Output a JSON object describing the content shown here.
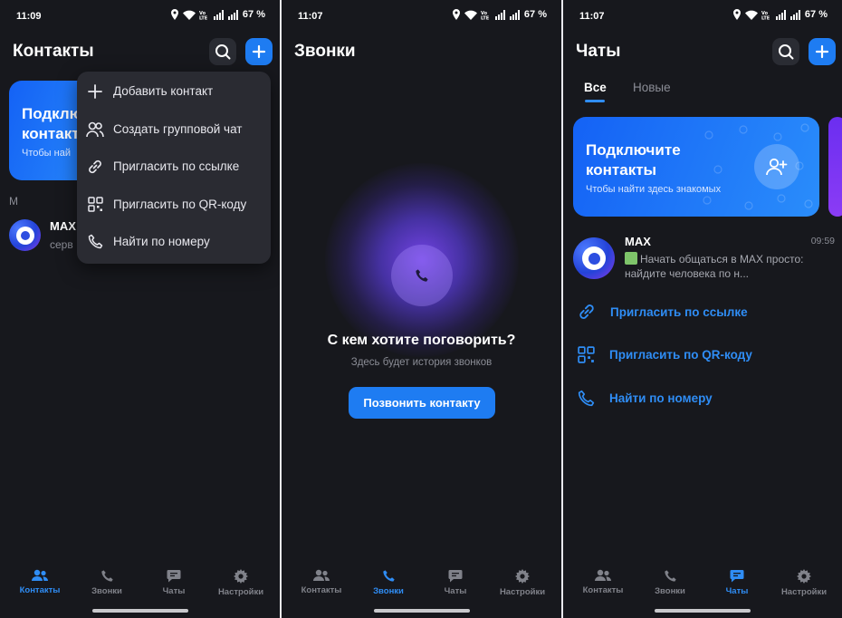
{
  "status": {
    "time1": "11:09",
    "time2": "11:07",
    "time3": "11:07",
    "battery": "67 %",
    "volte": "Vo\nLTE"
  },
  "contacts": {
    "title": "Контакты",
    "banner_title": "Подклю\nконтакт",
    "banner_sub": "Чтобы най",
    "section_letter": "М",
    "contact_name": "MAX",
    "contact_sub": "серв",
    "menu": [
      {
        "label": "Добавить контакт",
        "icon": "plus-icon"
      },
      {
        "label": "Создать групповой чат",
        "icon": "group-icon"
      },
      {
        "label": "Пригласить по ссылке",
        "icon": "link-icon"
      },
      {
        "label": "Пригласить по QR-коду",
        "icon": "qr-icon"
      },
      {
        "label": "Найти по номеру",
        "icon": "phone-icon"
      }
    ]
  },
  "calls": {
    "title": "Звонки",
    "empty_title": "С кем хотите поговорить?",
    "empty_sub": "Здесь будет история звонков",
    "button": "Позвонить контакту"
  },
  "chats": {
    "title": "Чаты",
    "tabs": [
      "Все",
      "Новые"
    ],
    "banner_title": "Подключите\nконтакты",
    "banner_sub": "Чтобы найти здесь знакомых",
    "chat": {
      "name": "MAX",
      "time": "09:59",
      "preview": "Начать общаться в MAX просто: найдите человека по н..."
    },
    "actions": [
      {
        "label": "Пригласить по ссылке",
        "icon": "link-icon"
      },
      {
        "label": "Пригласить по QR-коду",
        "icon": "qr-icon"
      },
      {
        "label": "Найти по номеру",
        "icon": "phone-icon"
      }
    ]
  },
  "nav": [
    "Контакты",
    "Звонки",
    "Чаты",
    "Настройки"
  ],
  "colors": {
    "accent": "#2f8df5",
    "background": "#17181d",
    "menu": "#2a2b32"
  }
}
